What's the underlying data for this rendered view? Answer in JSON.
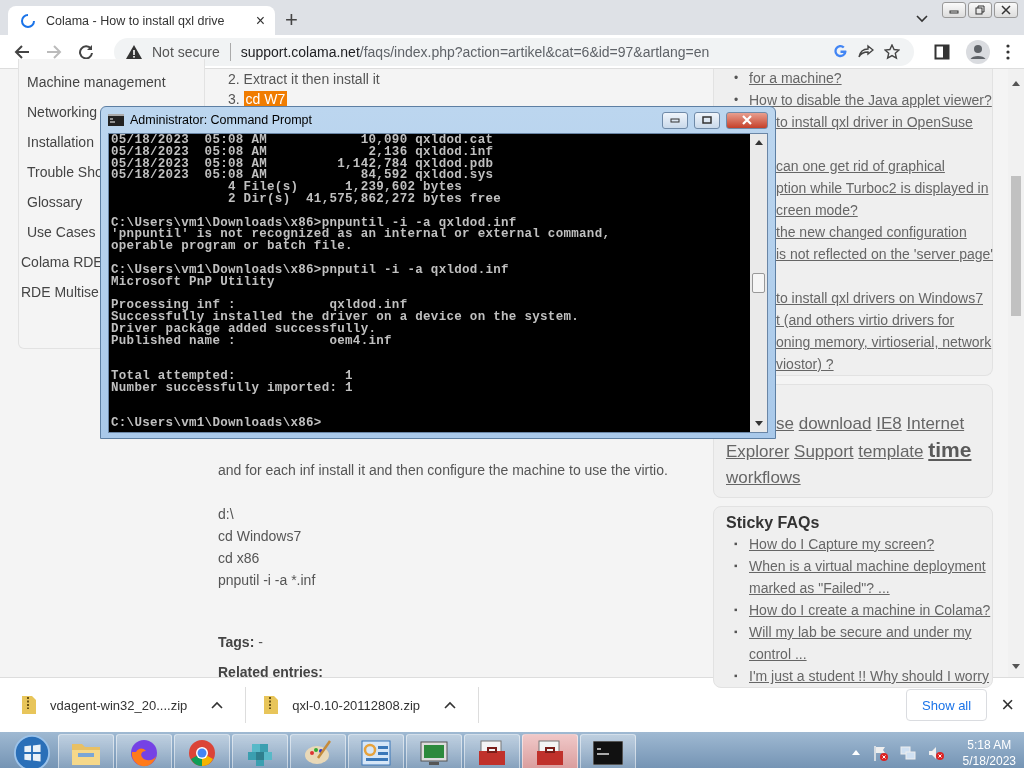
{
  "browser": {
    "tab": {
      "title": "Colama - How to install qxl drive",
      "close": "×"
    },
    "new_tab": "+",
    "back": {
      "disabled": false
    },
    "forward": {
      "disabled": true
    },
    "address": {
      "security": "Not secure",
      "host": "support.colama.net",
      "path": "/faqs/index.php?action=artikel&cat=6&id=97&artlang=en"
    }
  },
  "sidebar": {
    "items": [
      {
        "label": "Machine management",
        "kind": "sub"
      },
      {
        "label": "Networking",
        "kind": "sub"
      },
      {
        "label": "Installation",
        "kind": "sub"
      },
      {
        "label": "Trouble Sho",
        "kind": "sub"
      },
      {
        "label": "Glossary",
        "kind": "sub"
      },
      {
        "label": "Use Cases",
        "kind": "sub"
      },
      {
        "label": "Colama RDE",
        "kind": "top"
      },
      {
        "label": "RDE Multise",
        "kind": "top"
      }
    ]
  },
  "article": {
    "steps": [
      {
        "number": "2.",
        "text": "Extract it  then install it",
        "highlighted": false
      },
      {
        "number": "3.",
        "text": "cd W7",
        "highlighted": true
      }
    ],
    "paragraph": "and for each inf install it and then configure the machine to use the virtio.",
    "commands": [
      "d:\\",
      "cd Windows7",
      "cd x86",
      "pnputil -i -a *.inf"
    ],
    "tags": {
      "label": "Tags:",
      "value": "-"
    },
    "related_heading": "Related entries:"
  },
  "related_faqs": [
    {
      "marker": "•",
      "lines": [
        "for a machine?"
      ],
      "clipped": false,
      "hidden_last_line": false
    },
    {
      "marker": "•",
      "lines": [
        "How to disable the Java applet viewer?"
      ],
      "clipped": false,
      "hidden_last_line": false
    },
    {
      "lines": [
        "to install qxl driver in OpenSuse"
      ],
      "clipped": true,
      "hidden_last_line": true
    },
    {
      "lines": [
        "can one get rid of graphical",
        "ption while Turboc2 is displayed in",
        "creen mode?"
      ],
      "clipped": true,
      "hidden_last_line": false
    },
    {
      "lines": [
        "the new changed configuration",
        "is not reflected on the 'server page'"
      ],
      "clipped": true,
      "hidden_last_line": true
    },
    {
      "lines": [
        "to install qxl drivers on Windows7",
        "t (and others virtio drivers for",
        "oning memory, virtioserial, network",
        "viostor) ?"
      ],
      "clipped": true,
      "hidden_last_line": false
    }
  ],
  "tag_cloud": {
    "first_line_covered": true,
    "tags": [
      {
        "text": "se",
        "kind": "normal"
      },
      {
        "text": "download",
        "kind": "normal"
      },
      {
        "text": "IE8",
        "kind": "normal"
      },
      {
        "text": "Internet",
        "kind": "normal"
      },
      {
        "text": "Explorer",
        "kind": "normal"
      },
      {
        "text": "Support",
        "kind": "normal"
      },
      {
        "text": "template",
        "kind": "normal"
      },
      {
        "text": "time",
        "kind": "large"
      },
      {
        "text": "workflows",
        "kind": "normal"
      }
    ]
  },
  "sticky_faqs": {
    "title": "Sticky FAQs",
    "items": [
      {
        "marker": "▪",
        "lines": [
          "How do I Capture my screen?"
        ]
      },
      {
        "marker": "▪",
        "lines": [
          "When is a virtual machine deployment",
          "marked as \"Failed\"? ..."
        ]
      },
      {
        "marker": "▪",
        "lines": [
          "How do I create a machine in Colama?"
        ]
      },
      {
        "marker": "▪",
        "lines": [
          "Will my lab be secure and under my",
          "control ..."
        ]
      },
      {
        "marker": "▪",
        "lines": [
          "I'm just a student !! Why should I worry"
        ]
      }
    ]
  },
  "console_window": {
    "title": "Administrator:  Command Prompt",
    "text": "05/18/2023  05:08 AM            10,090 qxldod.cat\n05/18/2023  05:08 AM             2,136 qxldod.inf\n05/18/2023  05:08 AM         1,142,784 qxldod.pdb\n05/18/2023  05:08 AM            84,592 qxldod.sys\n               4 File(s)      1,239,602 bytes\n               2 Dir(s)  41,575,862,272 bytes free\n\nC:\\Users\\vm1\\Downloads\\x86>pnpuntil -i -a qxldod.inf\n'pnpuntil' is not recognized as an internal or external command,\noperable program or batch file.\n\nC:\\Users\\vm1\\Downloads\\x86>pnputil -i -a qxldod.inf\nMicrosoft PnP Utility\n\nProcessing inf :            qxldod.inf\nSuccessfully installed the driver on a device on the system.\nDriver package added successfully.\nPublished name :            oem4.inf\n\n\nTotal attempted:              1\nNumber successfully imported: 1\n\n\nC:\\Users\\vm1\\Downloads\\x86>"
  },
  "downloads": {
    "items": [
      {
        "name": "vdagent-win32_20....zip"
      },
      {
        "name": "qxl-0.10-20112808.zip"
      }
    ],
    "show_all": "Show all",
    "close": "×"
  },
  "taskbar": {
    "items": [
      {
        "kind": "folder",
        "flashing": false
      },
      {
        "kind": "fox",
        "flashing": false
      },
      {
        "kind": "chrome",
        "flashing": false
      },
      {
        "kind": "cubes",
        "flashing": false
      },
      {
        "kind": "paint",
        "flashing": false
      },
      {
        "kind": "panel",
        "flashing": false
      },
      {
        "kind": "monitor",
        "flashing": false
      },
      {
        "kind": "toolbox",
        "flashing": false
      },
      {
        "kind": "toolbox",
        "flashing": true
      },
      {
        "kind": "console",
        "flashing": false
      }
    ],
    "clock": {
      "time": "5:18 AM",
      "date": "5/18/2023"
    }
  }
}
